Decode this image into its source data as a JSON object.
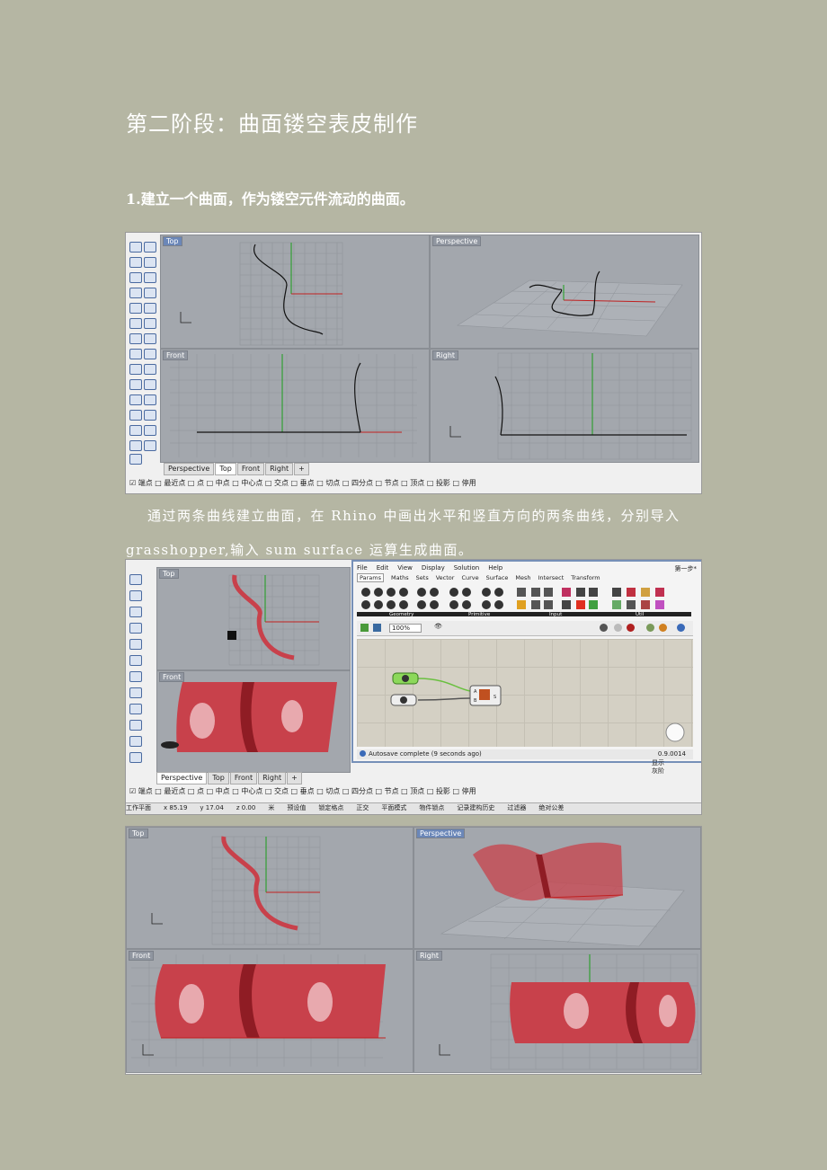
{
  "title": "第二阶段：曲面镂空表皮制作",
  "step1": "1.建立一个曲面，作为镂空元件流动的曲面。",
  "para1": "通过两条曲线建立曲面，在 Rhino  中画出水平和竖直方向的两条曲线，分别导入grasshopper,输入 sum surface 运算生成曲面。",
  "viewports": {
    "top": "Top",
    "perspective": "Perspective",
    "front": "Front",
    "right": "Right"
  },
  "bottom_tabs": [
    "Perspective",
    "Top",
    "Front",
    "Right"
  ],
  "osnaps": [
    "端点",
    "最近点",
    "点",
    "中点",
    "中心点",
    "交点",
    "垂点",
    "切点",
    "四分点",
    "节点",
    "顶点",
    "投影",
    "停用"
  ],
  "statusbar": {
    "plane": "工作平面",
    "x": "x 85.19",
    "y": "y 17.04",
    "z": "z 0.00",
    "unit": "米",
    "layer": "预设值",
    "lock": "锁定格点",
    "ortho": "正交",
    "planar": "平面模式",
    "osnap": "物件锁点",
    "history": "记录建构历史",
    "filter": "过滤器",
    "abs": "绝对公差"
  },
  "grasshopper": {
    "menu": [
      "File",
      "Edit",
      "View",
      "Display",
      "Solution",
      "Help"
    ],
    "doc": "第一步*",
    "tabs": [
      "Params",
      "Maths",
      "Sets",
      "Vector",
      "Curve",
      "Surface",
      "Mesh",
      "Intersect",
      "Transform"
    ],
    "groups": [
      "Geometry",
      "Primitive",
      "Input",
      "Util"
    ],
    "zoom": "100%",
    "autosave": "Autosave complete (9 seconds ago)",
    "version": "0.9.0014",
    "node_inputs": [
      "A",
      "B"
    ],
    "node_output": "S"
  },
  "side_labels": [
    "显示",
    "灰阶"
  ],
  "colors": {
    "surface": "#c8414b",
    "viewport": "#a3a7ad",
    "page": "#b5b6a3"
  }
}
